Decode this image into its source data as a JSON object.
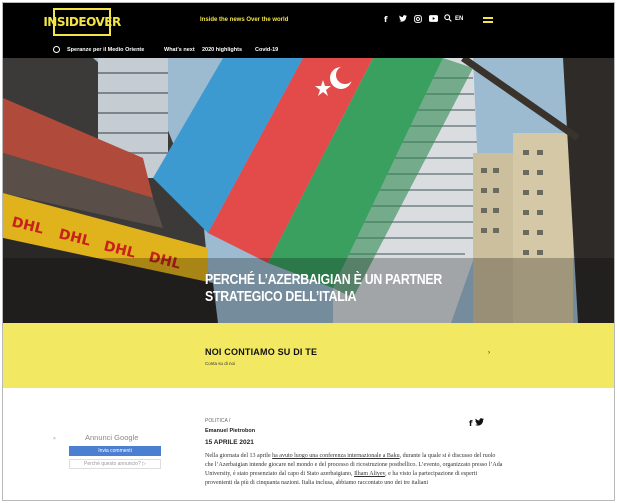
{
  "header": {
    "logo_text": "INSIDEOVER",
    "tagline": "Inside the news Over the world",
    "social_icons": [
      "facebook-icon",
      "twitter-icon",
      "instagram-icon",
      "youtube-icon"
    ],
    "search_icon": "search-icon",
    "lang": "EN",
    "accent_color": "#f2e545"
  },
  "nav": {
    "items": [
      "Speranze per il Medio Oriente",
      "What's next",
      "2020 highlights",
      "Covid-19"
    ]
  },
  "hero": {
    "title": "Perché l’Azerbaigian è un partner strategico dell’Italia",
    "flag_colors": [
      "#3d9ad1",
      "#e34a4a",
      "#3aa060"
    ]
  },
  "band": {
    "title": "NOI CONTIAMO SU DI TE",
    "subtitle": "Conta su di noi",
    "arrow": "›",
    "color": "#f2e861"
  },
  "ad": {
    "close": "×",
    "title": "Annunci Google",
    "button": "Invia commenti",
    "why": "Perché questo annuncio? ▷"
  },
  "article": {
    "category": "POLITICA /",
    "author": "Emanuel Pietrobon",
    "date": "15 APRILE 2021",
    "share_icons": [
      "facebook-icon",
      "twitter-icon"
    ],
    "body_1": "Nella giornata del 13 aprile ",
    "body_link_1": "ha avuto luogo una conferenza internazionale a Baku",
    "body_2": ", durante la quale si è discusso del ruolo che l’Azerbaigian intende giocare nel mondo e del processo di ricostruzione postbellico. L’evento, organizzato presso l’Ada University, è stato presenziato dal capo di Stato azerbaigiano, ",
    "body_link_2": "Ilham Aliyev",
    "body_3": ", e ha visto la partecipazione di esperti provenienti da più di cinquanta nazioni. Italia inclusa, abbiamo raccontato uno dei tre italiani"
  }
}
